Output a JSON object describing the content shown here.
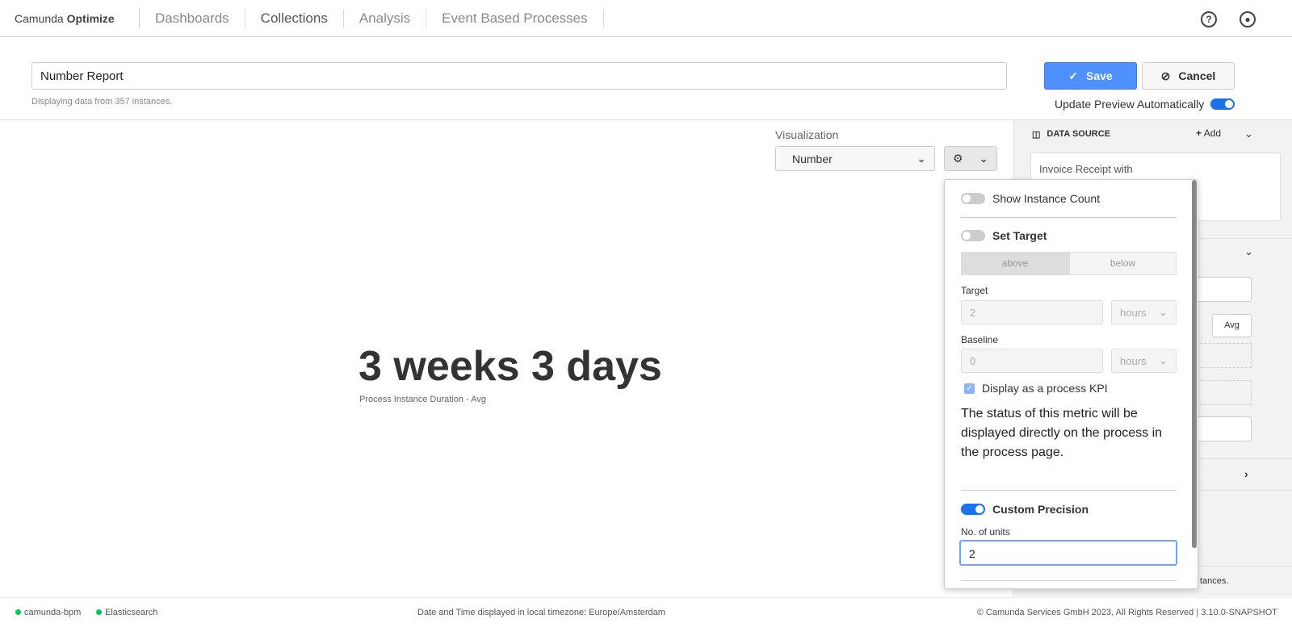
{
  "nav": {
    "brand_light": "Camunda",
    "brand_bold": "Optimize",
    "items": [
      "Dashboards",
      "Collections",
      "Analysis",
      "Event Based Processes"
    ],
    "help_icon": "help-circle-icon",
    "user_icon": "user-circle-icon"
  },
  "header": {
    "report_name": "Number Report",
    "subtitle": "Displaying data from 357 instances.",
    "save_label": "Save",
    "cancel_label": "Cancel",
    "update_preview_label": "Update Preview Automatically",
    "update_preview_on": true
  },
  "visualization": {
    "label": "Visualization",
    "selected": "Number"
  },
  "report": {
    "value": "3 weeks 3 days",
    "caption": "Process Instance Duration - Avg"
  },
  "config_popover": {
    "show_instance_count": "Show Instance Count",
    "show_instance_count_on": false,
    "set_target": "Set Target",
    "set_target_on": false,
    "above": "above",
    "below": "below",
    "target_label": "Target",
    "target_value": "2",
    "target_unit": "hours",
    "baseline_label": "Baseline",
    "baseline_value": "0",
    "baseline_unit": "hours",
    "kpi_label": "Display as a process KPI",
    "kpi_checked": true,
    "kpi_description": "The status of this metric will be displayed directly on the process in the process page.",
    "custom_precision": "Custom Precision",
    "custom_precision_on": true,
    "units_label": "No. of units",
    "units_value": "2"
  },
  "sidebar": {
    "data_source": "DATA SOURCE",
    "add": "Add",
    "source_name": "Invoice Receipt with",
    "avg": "Avg",
    "instances_fragment": "tances."
  },
  "footer": {
    "engine": "camunda-bpm",
    "db": "Elasticsearch",
    "timezone": "Date and Time displayed in local timezone: Europe/Amsterdam",
    "copyright": "© Camunda Services GmbH 2023, All Rights Reserved | 3.10.0-SNAPSHOT"
  },
  "colors": {
    "primary": "#4d90fe",
    "toggle_on": "#1a73e8",
    "status_ok": "#00c853"
  }
}
